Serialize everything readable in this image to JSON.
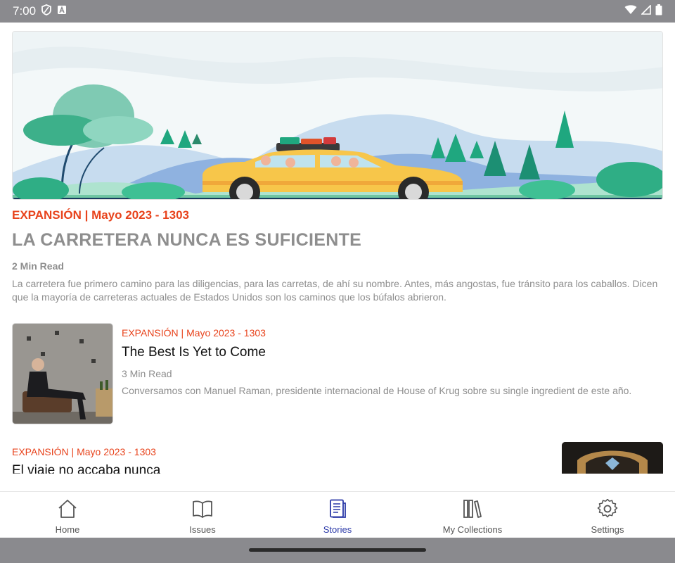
{
  "status_bar": {
    "time": "7:00"
  },
  "hero": {
    "kicker": "EXPANSIÓN | Mayo 2023 - 1303",
    "title": "LA CARRETERA NUNCA ES SUFICIENTE",
    "read_time": "2 Min Read",
    "summary": "La carretera fue primero camino para las diligencias, para las carretas, de ahí su nombre. Antes, más angostas, fue tránsito para los caballos. Dicen que la mayoría de carreteras actuales de Estados Unidos son los caminos que los búfalos abrieron."
  },
  "stories": [
    {
      "kicker": "EXPANSIÓN | Mayo 2023 - 1303",
      "title": "The Best Is Yet to Come",
      "read_time": "3 Min Read",
      "summary": "Conversamos con Manuel Raman, presidente internacional de House of Krug sobre su single ingredient de este año."
    },
    {
      "kicker": "EXPANSIÓN | Mayo 2023 - 1303",
      "title": "El viaje no accaba nunca"
    }
  ],
  "nav": {
    "items": [
      {
        "label": "Home",
        "icon": "home-icon"
      },
      {
        "label": "Issues",
        "icon": "book-open-icon"
      },
      {
        "label": "Stories",
        "icon": "article-icon",
        "active": true
      },
      {
        "label": "My Collections",
        "icon": "library-icon"
      },
      {
        "label": "Settings",
        "icon": "gear-icon"
      }
    ]
  },
  "colors": {
    "accent": "#e8431c",
    "active_nav": "#2c3aa8",
    "system_bar": "#8a8a8e"
  }
}
